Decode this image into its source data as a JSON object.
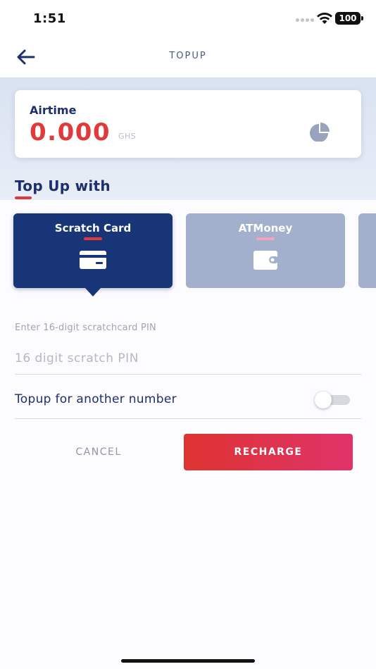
{
  "status_bar": {
    "time": "1:51",
    "battery": "100"
  },
  "header": {
    "title": "TOPUP",
    "back_icon": "arrow-left-icon"
  },
  "airtime": {
    "label": "Airtime",
    "amount": "0.000",
    "currency": "GHS",
    "icon": "pie-chart-icon"
  },
  "section": {
    "title": "Top Up with"
  },
  "methods": [
    {
      "label": "Scratch Card",
      "icon": "card-icon",
      "selected": true
    },
    {
      "label": "ATMoney",
      "icon": "wallet-icon",
      "selected": false
    }
  ],
  "pin": {
    "label": "Enter 16-digit scratchcard PIN",
    "placeholder": "16 digit scratch PIN",
    "value": ""
  },
  "another_number": {
    "label": "Topup for another number",
    "enabled": false
  },
  "actions": {
    "cancel": "CANCEL",
    "recharge": "RECHARGE"
  },
  "colors": {
    "primary": "#173577",
    "accent": "#e13a3b",
    "inactive_card": "#a2afcd"
  }
}
